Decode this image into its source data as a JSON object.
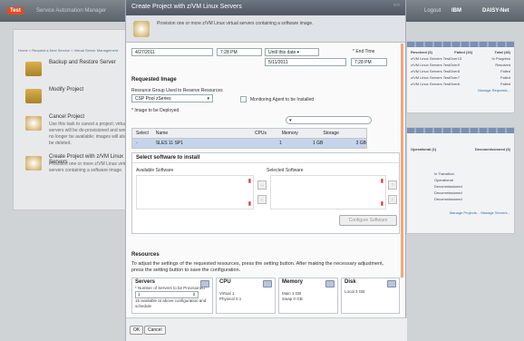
{
  "app": {
    "logo": "Test",
    "title": "Service Automation Manager",
    "top_right": [
      "Logout",
      "IBM",
      "DAISY-Net"
    ]
  },
  "background": {
    "breadcrumb": "Home > Request a New Service > Virtual Server Management",
    "tasks": [
      {
        "title": "Backup and Restore Server"
      },
      {
        "title": "Modify Project"
      },
      {
        "title": "Cancel Project",
        "desc": "Use this task to cancel a project; virtual servers will be de-provisioned and would no longer be available; images will also be deleted."
      },
      {
        "title": "Create Project with z/VM Linux Servers",
        "desc": "Provision one or more z/VM Linux virtual servers containing a software image."
      }
    ],
    "right_top": {
      "headers": [
        "Resolved (3)",
        "Failed (16)",
        "Total (28)"
      ],
      "rows": [
        [
          "z/VM Linux Servers TestOver13",
          "In Progress"
        ],
        [
          "z/VM Linux Servers TestOver9",
          "Resolved"
        ],
        [
          "z/VM Linux Servers TestOver8",
          "Failed"
        ],
        [
          "z/VM Linux Servers TestOver7",
          "Failed"
        ],
        [
          "z/VM Linux Servers TestOver6",
          "Failed"
        ]
      ],
      "link": "Manage Requests..."
    },
    "right_bottom": {
      "headers": [
        "Operational (1)",
        "Decommissioned (6)"
      ],
      "rows": [
        "In Transition",
        "Operational",
        "Decommissioned",
        "Decommissioned",
        "Decommissioned"
      ],
      "links": [
        "Manage Projects...",
        "Manage Servers..."
      ]
    }
  },
  "dialog": {
    "title": "Create Project with z/VM Linux Servers",
    "subtitle": "Provision one or more z/VM Linux virtual servers containing a software image.",
    "start_date": "4/27/2011",
    "start_time": "7:28 PM",
    "until_select": "Until this date",
    "end_date": "5/11/2011",
    "end_time_label": "* End Time",
    "end_time": "7:28 PM",
    "requested_image": "Requested Image",
    "resource_group_label": "Resource Group Used to Reserve Resources",
    "resource_group": "CSP Pool zSeries",
    "monitoring_label": "Monitoring Agent to be Installed",
    "image_label": "* Image to be Deployed",
    "table": {
      "headers": [
        "Select",
        "Name",
        "CPUs",
        "Memory",
        "Storage"
      ],
      "rows": [
        [
          "",
          "SLES 11 SP1",
          "1",
          "1 GB",
          "3 GB"
        ]
      ]
    },
    "software": {
      "heading": "Select software to install",
      "available": "Available Software",
      "selected": "Selected Software",
      "configure": "Configure Software"
    },
    "resources": {
      "heading": "Resources",
      "text": "To adjust the settings of the requested resources, press the setting button. After making the necessary adjustment, press the setting button to save the configuration.",
      "servers": {
        "title": "Servers",
        "label": "* Number of Servers to be Provisioned",
        "value": "1",
        "note": "15 available at above configuration and schedule"
      },
      "cpu": {
        "title": "CPU",
        "virtual": "Virtual  1",
        "physical": "Physical  0.1"
      },
      "memory": {
        "title": "Memory",
        "main": "Main  1 GB",
        "swap": "Swap  0 GB"
      },
      "disk": {
        "title": "Disk",
        "local": "Local  3 GB"
      }
    },
    "ok": "OK",
    "cancel": "Cancel"
  }
}
